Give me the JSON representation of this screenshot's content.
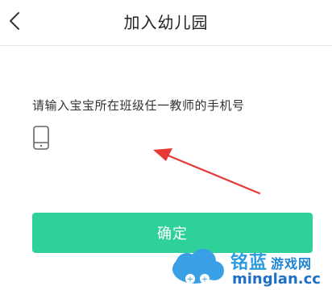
{
  "header": {
    "title": "加入幼儿园",
    "back_icon": "chevron-left-icon"
  },
  "form": {
    "prompt": "请输入宝宝所在班级任一教师的手机号",
    "phone_icon": "phone-icon",
    "phone_value": "",
    "confirm_label": "确定"
  },
  "watermark": {
    "brand_cn": "铭蓝",
    "brand_cn2": "游戏网",
    "domain": "minglan.cc"
  },
  "colors": {
    "accent": "#2ed19a",
    "annotation_arrow": "#e53935"
  }
}
